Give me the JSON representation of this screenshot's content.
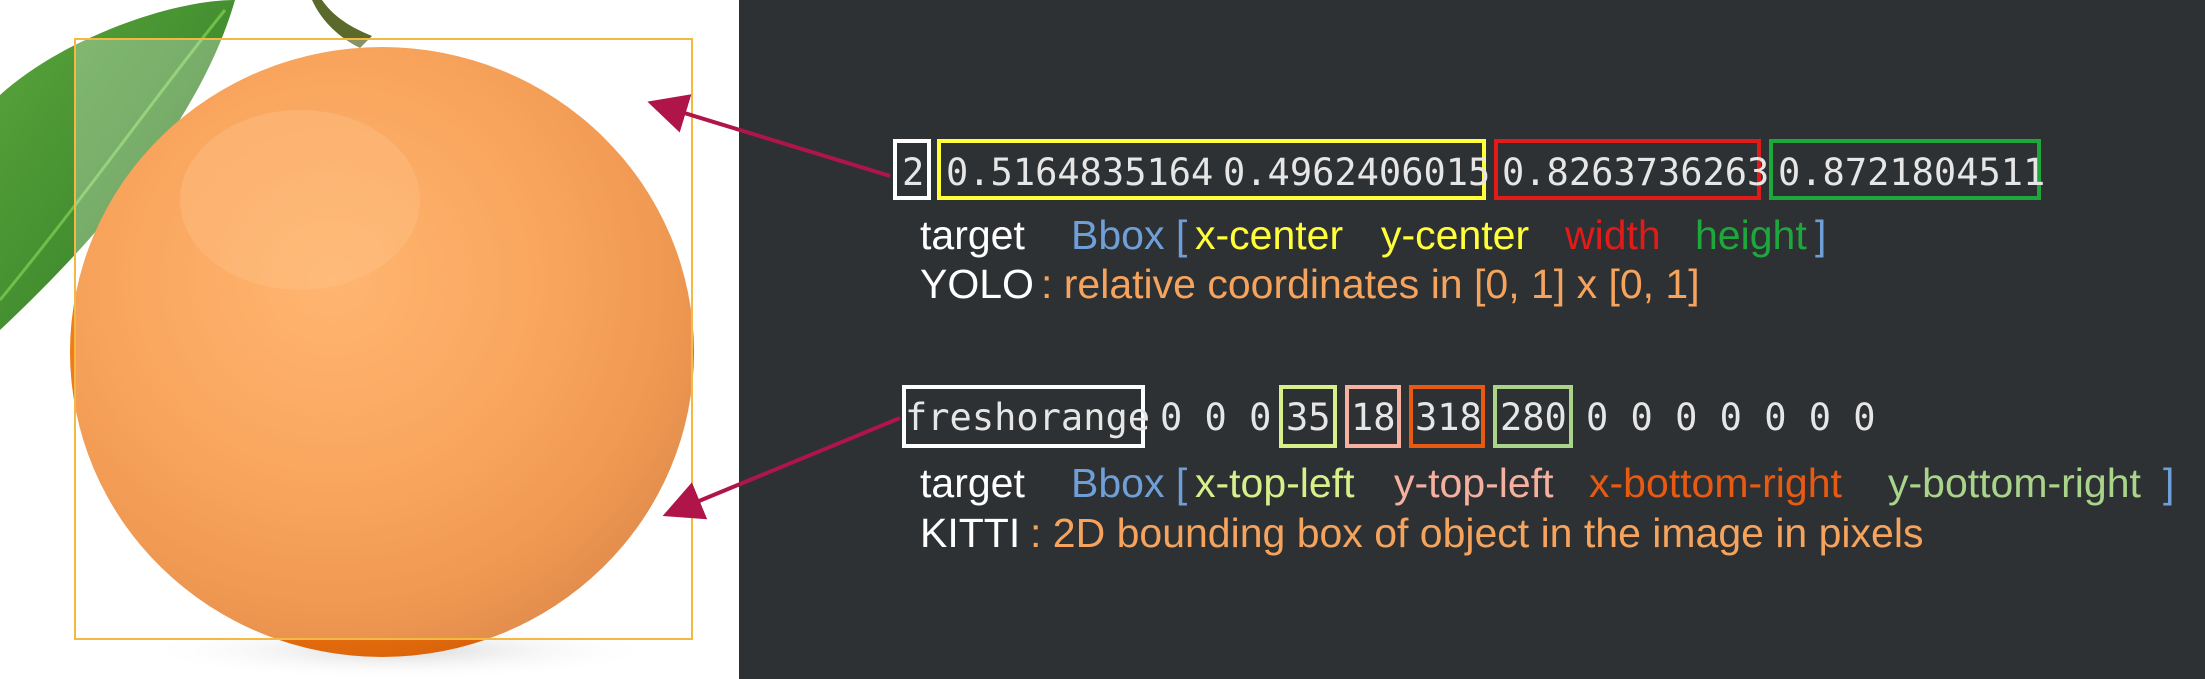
{
  "colors": {
    "panel_background": "#2e3133",
    "white": "#ffffff",
    "light_blue": "#6f9fd8",
    "yellow": "#ffff3a",
    "red": "#e11a1a",
    "green": "#1ea83c",
    "orange": "#f5a35d",
    "pale_green": "#d8f08a",
    "pink": "#f5b0a0",
    "dark_orange": "#e85a12",
    "sage": "#a9d48a",
    "arrow": "#b0154a",
    "bbox": "#f4b942"
  },
  "image": {
    "description_icon": "orange-fruit-image"
  },
  "yolo": {
    "class_id": "2",
    "x_center": "0.5164835164",
    "y_center": "0.4962406015",
    "width": "0.8263736263",
    "height": "0.8721804511",
    "label_target": "target",
    "label_bbox_open": "Bbox [",
    "label_xcenter": "x-center",
    "label_ycenter": "y-center",
    "label_width": "width",
    "label_height": "height",
    "label_close": "]",
    "format_name": "YOLO",
    "format_desc": ": relative coordinates in [0, 1] x [0, 1]"
  },
  "kitti": {
    "class_name": "freshorange",
    "zeros_before": "0 0 0",
    "x_top_left": "35",
    "y_top_left": "18",
    "x_bottom_right": "318",
    "y_bottom_right": "280",
    "zeros_after": "0 0 0 0 0 0 0",
    "label_target": "target",
    "label_bbox_open": "Bbox [",
    "label_xtl": "x-top-left",
    "label_ytl": "y-top-left",
    "label_xbr": "x-bottom-right",
    "label_ybr": "y-bottom-right",
    "label_close": "]",
    "format_name": "KITTI",
    "format_desc": ": 2D bounding box of object in the image in pixels"
  }
}
